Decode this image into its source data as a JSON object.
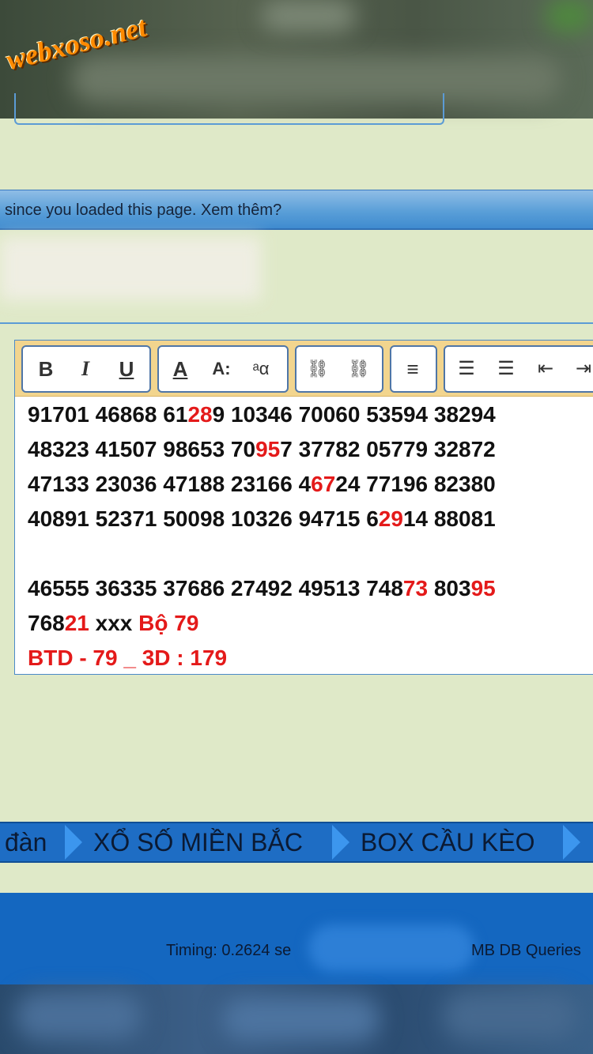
{
  "watermark": {
    "logo_text": "webxoso.net"
  },
  "notice": {
    "text": "since you loaded this page. Xem thêm?"
  },
  "toolbar": {
    "groups": [
      {
        "buttons": [
          {
            "name": "bold",
            "glyph": "B"
          },
          {
            "name": "italic",
            "glyph": "I"
          },
          {
            "name": "underline",
            "glyph": "U"
          }
        ]
      },
      {
        "buttons": [
          {
            "name": "text-color",
            "glyph": "A"
          },
          {
            "name": "font-size",
            "glyph": "A:"
          },
          {
            "name": "font-family",
            "glyph": "ᵃα"
          }
        ]
      },
      {
        "buttons": [
          {
            "name": "link",
            "glyph": "⛓"
          },
          {
            "name": "unlink",
            "glyph": "⛓"
          }
        ]
      },
      {
        "buttons": [
          {
            "name": "align",
            "glyph": "≡"
          }
        ]
      },
      {
        "buttons": [
          {
            "name": "bullet-list",
            "glyph": "☰"
          },
          {
            "name": "numbered-list",
            "glyph": "☰"
          },
          {
            "name": "outdent",
            "glyph": "⇤"
          },
          {
            "name": "indent",
            "glyph": "⇥"
          }
        ]
      }
    ]
  },
  "editor": {
    "lines": [
      [
        {
          "t": "91701 46868 61"
        },
        {
          "t": "28",
          "red": true
        },
        {
          "t": "9 10346 70060 53594 38294"
        }
      ],
      [
        {
          "t": "48323 41507 98653 70"
        },
        {
          "t": "95",
          "red": true
        },
        {
          "t": "7 37782 05779 32872"
        }
      ],
      [
        {
          "t": "47133 23036 47188 23166 4"
        },
        {
          "t": "67",
          "red": true
        },
        {
          "t": "24 77196 82380"
        }
      ],
      [
        {
          "t": "40891 52371 50098 10326 94715 6"
        },
        {
          "t": "29",
          "red": true
        },
        {
          "t": "14 88081"
        }
      ],
      [
        {
          "t": ""
        }
      ],
      [
        {
          "t": "46555 36335 37686 27492 49513 748"
        },
        {
          "t": "73",
          "red": true
        },
        {
          "t": " 803"
        },
        {
          "t": "95",
          "red": true
        }
      ],
      [
        {
          "t": "768"
        },
        {
          "t": "21",
          "red": true
        },
        {
          "t": " xxx "
        },
        {
          "t": "Bộ 79",
          "red": true
        }
      ],
      [
        {
          "t": "BTD - 79 _ 3D : 179",
          "red": true
        }
      ]
    ]
  },
  "nav": {
    "items": [
      "đàn",
      "XỔ SỐ MIỀN BẮC",
      "BOX CẦU KÈO"
    ]
  },
  "footer": {
    "timing": "Timing: 0.2624 se",
    "db": "MB DB Queries"
  },
  "colors": {
    "accent_red": "#e41a1a",
    "nav_blue": "#1e6dc4",
    "page_bg": "#dfe9c8"
  }
}
